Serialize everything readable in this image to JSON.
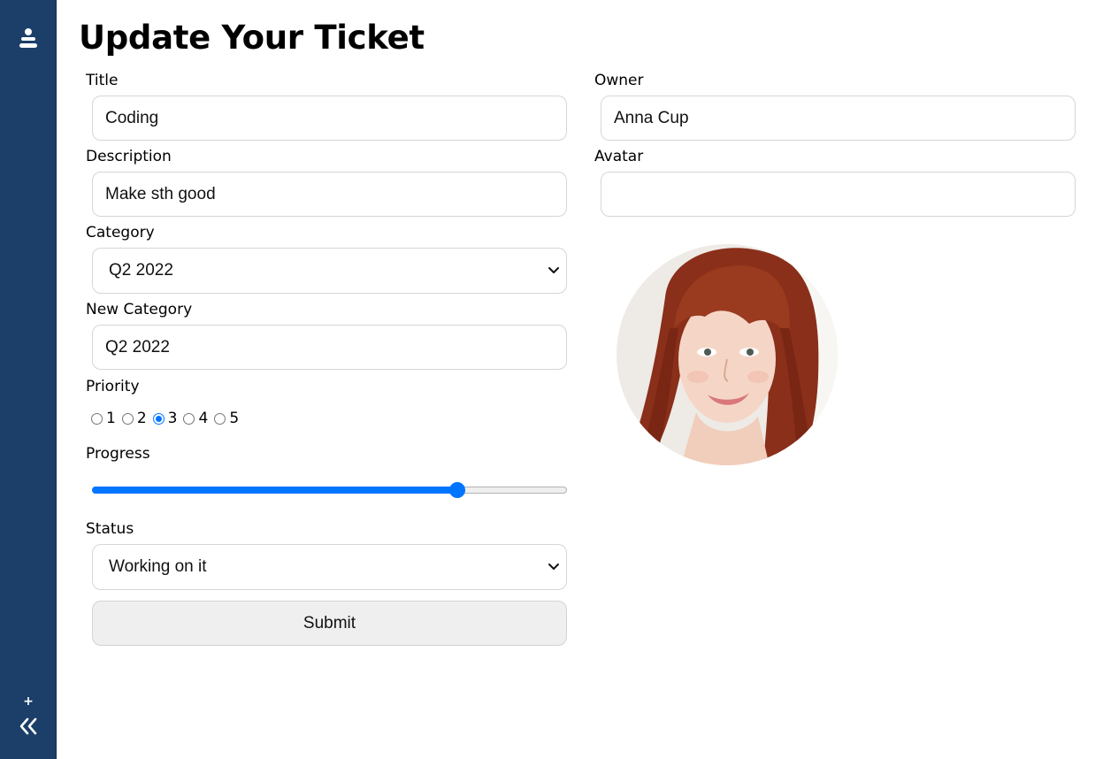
{
  "page": {
    "title": "Update Your Ticket"
  },
  "colors": {
    "sidebar": "#1b3f69",
    "accent": "#0075ff",
    "field_border": "#d6d6d6",
    "button_bg": "#efefef"
  },
  "sidebar": {
    "logo_icon": "ticket-stack-icon",
    "add_icon": "+",
    "collapse_icon": "double-chevron-left-icon"
  },
  "form": {
    "title": {
      "label": "Title",
      "value": "Coding"
    },
    "description": {
      "label": "Description",
      "value": "Make sth good"
    },
    "category": {
      "label": "Category",
      "selected": "Q2 2022"
    },
    "new_category": {
      "label": "New Category",
      "value": "Q2 2022"
    },
    "priority": {
      "label": "Priority",
      "options": [
        "1",
        "2",
        "3",
        "4",
        "5"
      ],
      "selected": "3"
    },
    "progress": {
      "label": "Progress",
      "value_percent": 77
    },
    "status": {
      "label": "Status",
      "selected": "Working on it"
    },
    "owner": {
      "label": "Owner",
      "value": "Anna Cup"
    },
    "avatar": {
      "label": "Avatar",
      "value": ""
    },
    "submit_label": "Submit"
  }
}
